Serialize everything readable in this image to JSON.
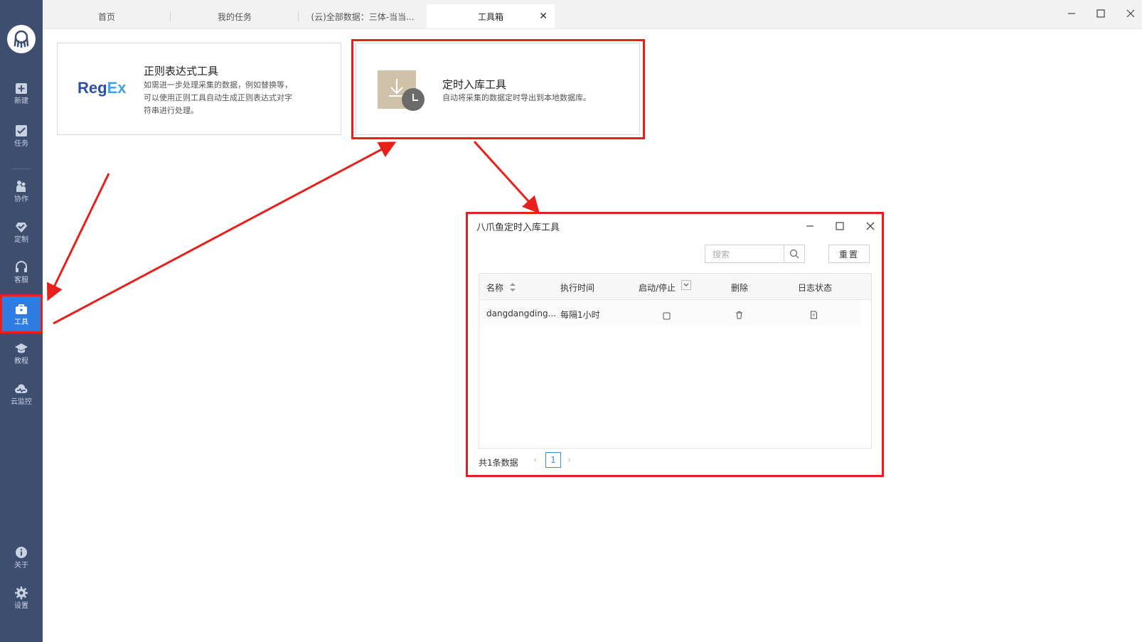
{
  "sidebar": {
    "items": [
      {
        "label": "新建",
        "icon": "new-icon"
      },
      {
        "label": "任务",
        "icon": "task-icon"
      },
      {
        "label": "协作",
        "icon": "collaborate-icon"
      },
      {
        "label": "定制",
        "icon": "customize-icon"
      },
      {
        "label": "客服",
        "icon": "headset-icon"
      },
      {
        "label": "工具",
        "icon": "toolbox-icon",
        "active": true
      },
      {
        "label": "教程",
        "icon": "graduation-cap-icon"
      },
      {
        "label": "云监控",
        "icon": "cloud-monitor-icon"
      },
      {
        "label": "关于",
        "icon": "info-icon"
      },
      {
        "label": "设置",
        "icon": "gear-icon"
      }
    ]
  },
  "tabs": [
    {
      "label": "首页"
    },
    {
      "label": "我的任务"
    },
    {
      "label": "(云)全部数据：三体-当当..."
    },
    {
      "label": "工具箱",
      "active": true
    }
  ],
  "tools": {
    "regex": {
      "logo_reg": "Reg",
      "logo_ex": "Ex",
      "title": "正则表达式工具",
      "desc_line1": "如需进一步处理采集的数据，例如替换等，",
      "desc_line2": "可以使用正则工具自动生成正则表达式对字",
      "desc_line3": "符串进行处理。"
    },
    "timer": {
      "title": "定时入库工具",
      "desc": "自动将采集的数据定时导出到本地数据库。"
    }
  },
  "dialog": {
    "title": "八爪鱼定时入库工具",
    "search_placeholder": "搜索",
    "reset_label": "重置",
    "columns": [
      "名称",
      "执行时间",
      "启动/停止",
      "删除",
      "日志状态"
    ],
    "rows": [
      {
        "name": "dangdangding...",
        "schedule": "每隔1小时"
      }
    ],
    "total_text": "共1条数据",
    "current_page": "1"
  },
  "colors": {
    "sidebar_bg": "#3d4e6e",
    "active_blue": "#2f7de1",
    "annotation_red": "#e8201b"
  }
}
